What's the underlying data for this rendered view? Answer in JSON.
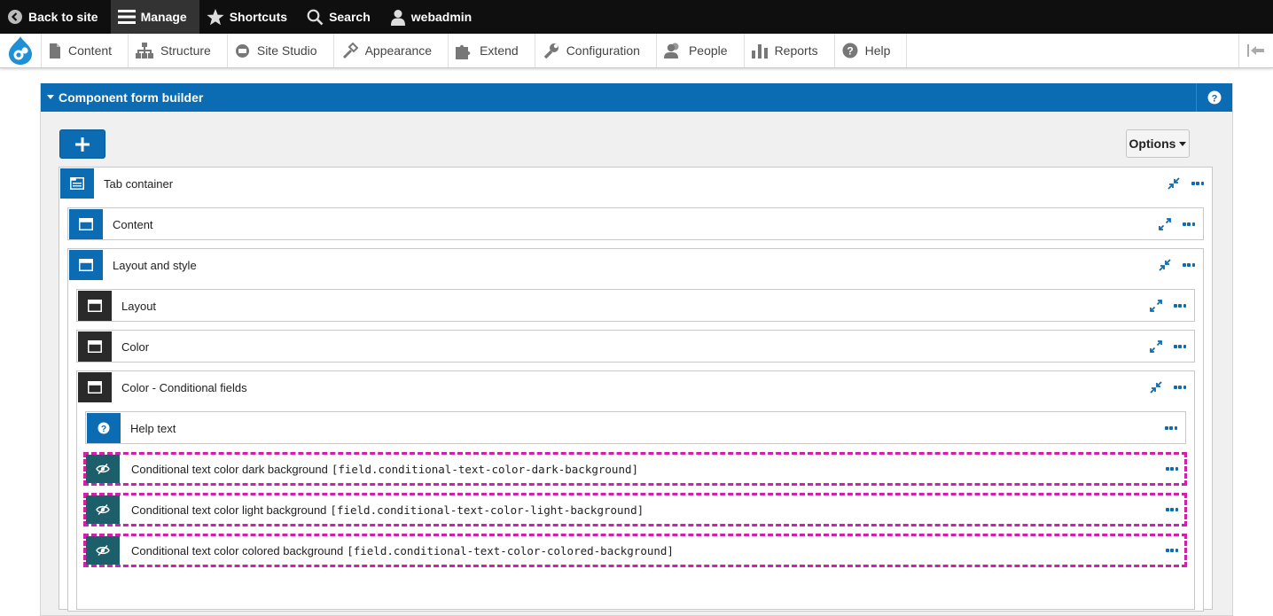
{
  "toolbar": {
    "back_label": "Back to site",
    "manage_label": "Manage",
    "shortcuts_label": "Shortcuts",
    "search_label": "Search",
    "user_label": "webadmin"
  },
  "tray": {
    "items": [
      {
        "label": "Content",
        "icon": "page-icon"
      },
      {
        "label": "Structure",
        "icon": "sitemap-icon"
      },
      {
        "label": "Site Studio",
        "icon": "site-studio-icon"
      },
      {
        "label": "Appearance",
        "icon": "paintbrush-icon"
      },
      {
        "label": "Extend",
        "icon": "puzzle-icon"
      },
      {
        "label": "Configuration",
        "icon": "wrench-icon"
      },
      {
        "label": "People",
        "icon": "people-icon"
      },
      {
        "label": "Reports",
        "icon": "bar-chart-icon"
      },
      {
        "label": "Help",
        "icon": "help-icon"
      }
    ]
  },
  "panel": {
    "title": "Component form builder",
    "options_label": "Options"
  },
  "form": {
    "tab_container": "Tab container",
    "content": "Content",
    "layout_and_style": "Layout and style",
    "layout": "Layout",
    "color": "Color",
    "color_conditional": "Color - Conditional fields",
    "help_text": "Help text",
    "conditional_fields": [
      {
        "label": "Conditional text color dark background",
        "machine": "[field.conditional-text-color-dark-background]"
      },
      {
        "label": "Conditional text color light background",
        "machine": "[field.conditional-text-color-light-background]"
      },
      {
        "label": "Conditional text color colored background",
        "machine": "[field.conditional-text-color-colored-background]"
      }
    ]
  },
  "colors": {
    "brand_blue": "#0c6cb3",
    "highlight_magenta": "#d11fb0",
    "condition_teal": "#1d5e6b",
    "dark_icon_bg": "#2a2a2a"
  }
}
